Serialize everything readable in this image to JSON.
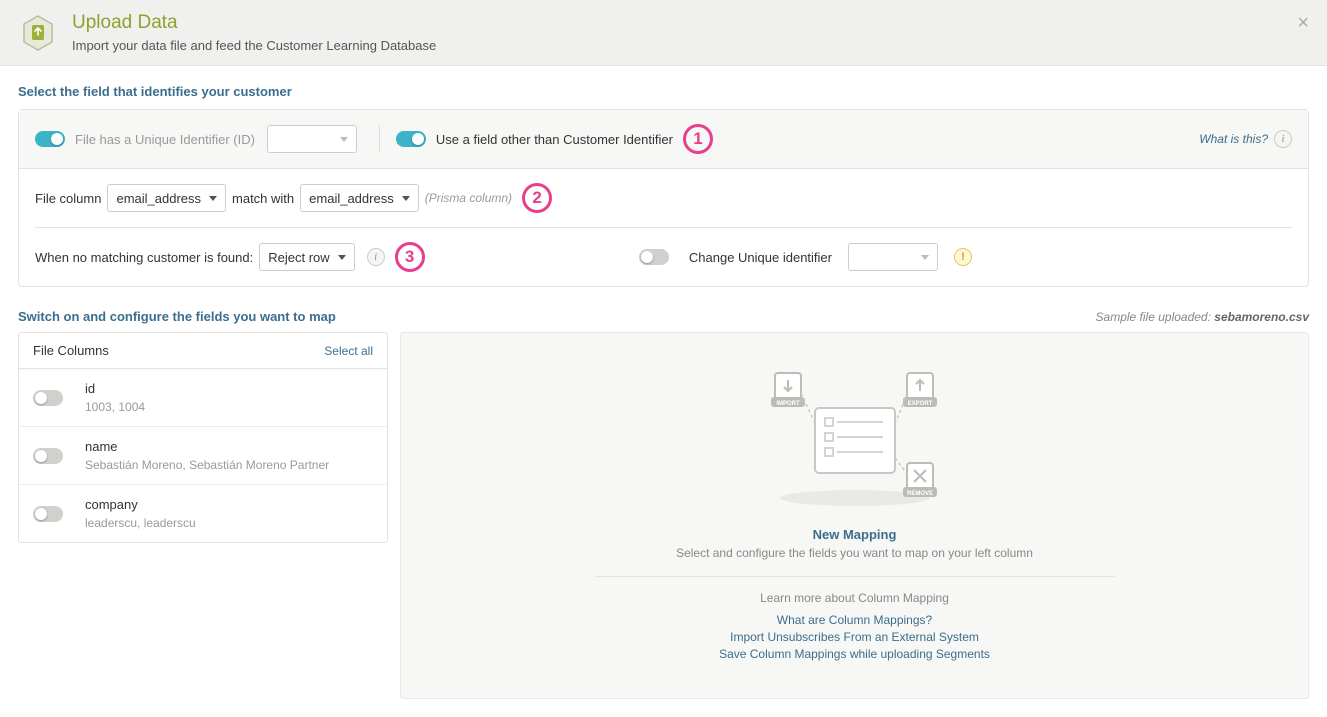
{
  "header": {
    "title": "Upload Data",
    "subtitle": "Import your data file and feed the Customer Learning Database"
  },
  "identity": {
    "section_title": "Select the field that identifies your customer",
    "unique_label": "File has a Unique Identifier (ID)",
    "other_field_label": "Use a field other than Customer Identifier",
    "what_is_this": "What is this?",
    "file_column_label": "File column",
    "file_column_value": "email_address",
    "match_with_label": "match with",
    "prisma_column_value": "email_address",
    "prisma_hint": "(Prisma column)",
    "no_match_label": "When no matching customer is found:",
    "no_match_value": "Reject row",
    "change_uid_label": "Change Unique identifier",
    "annot1": "1",
    "annot2": "2",
    "annot3": "3"
  },
  "mapping": {
    "section_title": "Switch on and configure the fields you want to map",
    "sample_prefix": "Sample file uploaded: ",
    "sample_file": "sebamoreno.csv",
    "file_columns_title": "File Columns",
    "select_all": "Select all",
    "columns": [
      {
        "name": "id",
        "sample": "1003, 1004"
      },
      {
        "name": "name",
        "sample": "Sebastián Moreno, Sebastián Moreno Partner"
      },
      {
        "name": "company",
        "sample": "leaderscu, leaderscu"
      }
    ],
    "empty": {
      "title": "New Mapping",
      "subtitle": "Select and configure the fields you want to map on your left column",
      "learn": "Learn more about Column Mapping",
      "links": [
        "What are Column Mappings?",
        "Import Unsubscribes From an External System",
        "Save Column Mappings while uploading Segments"
      ]
    }
  }
}
